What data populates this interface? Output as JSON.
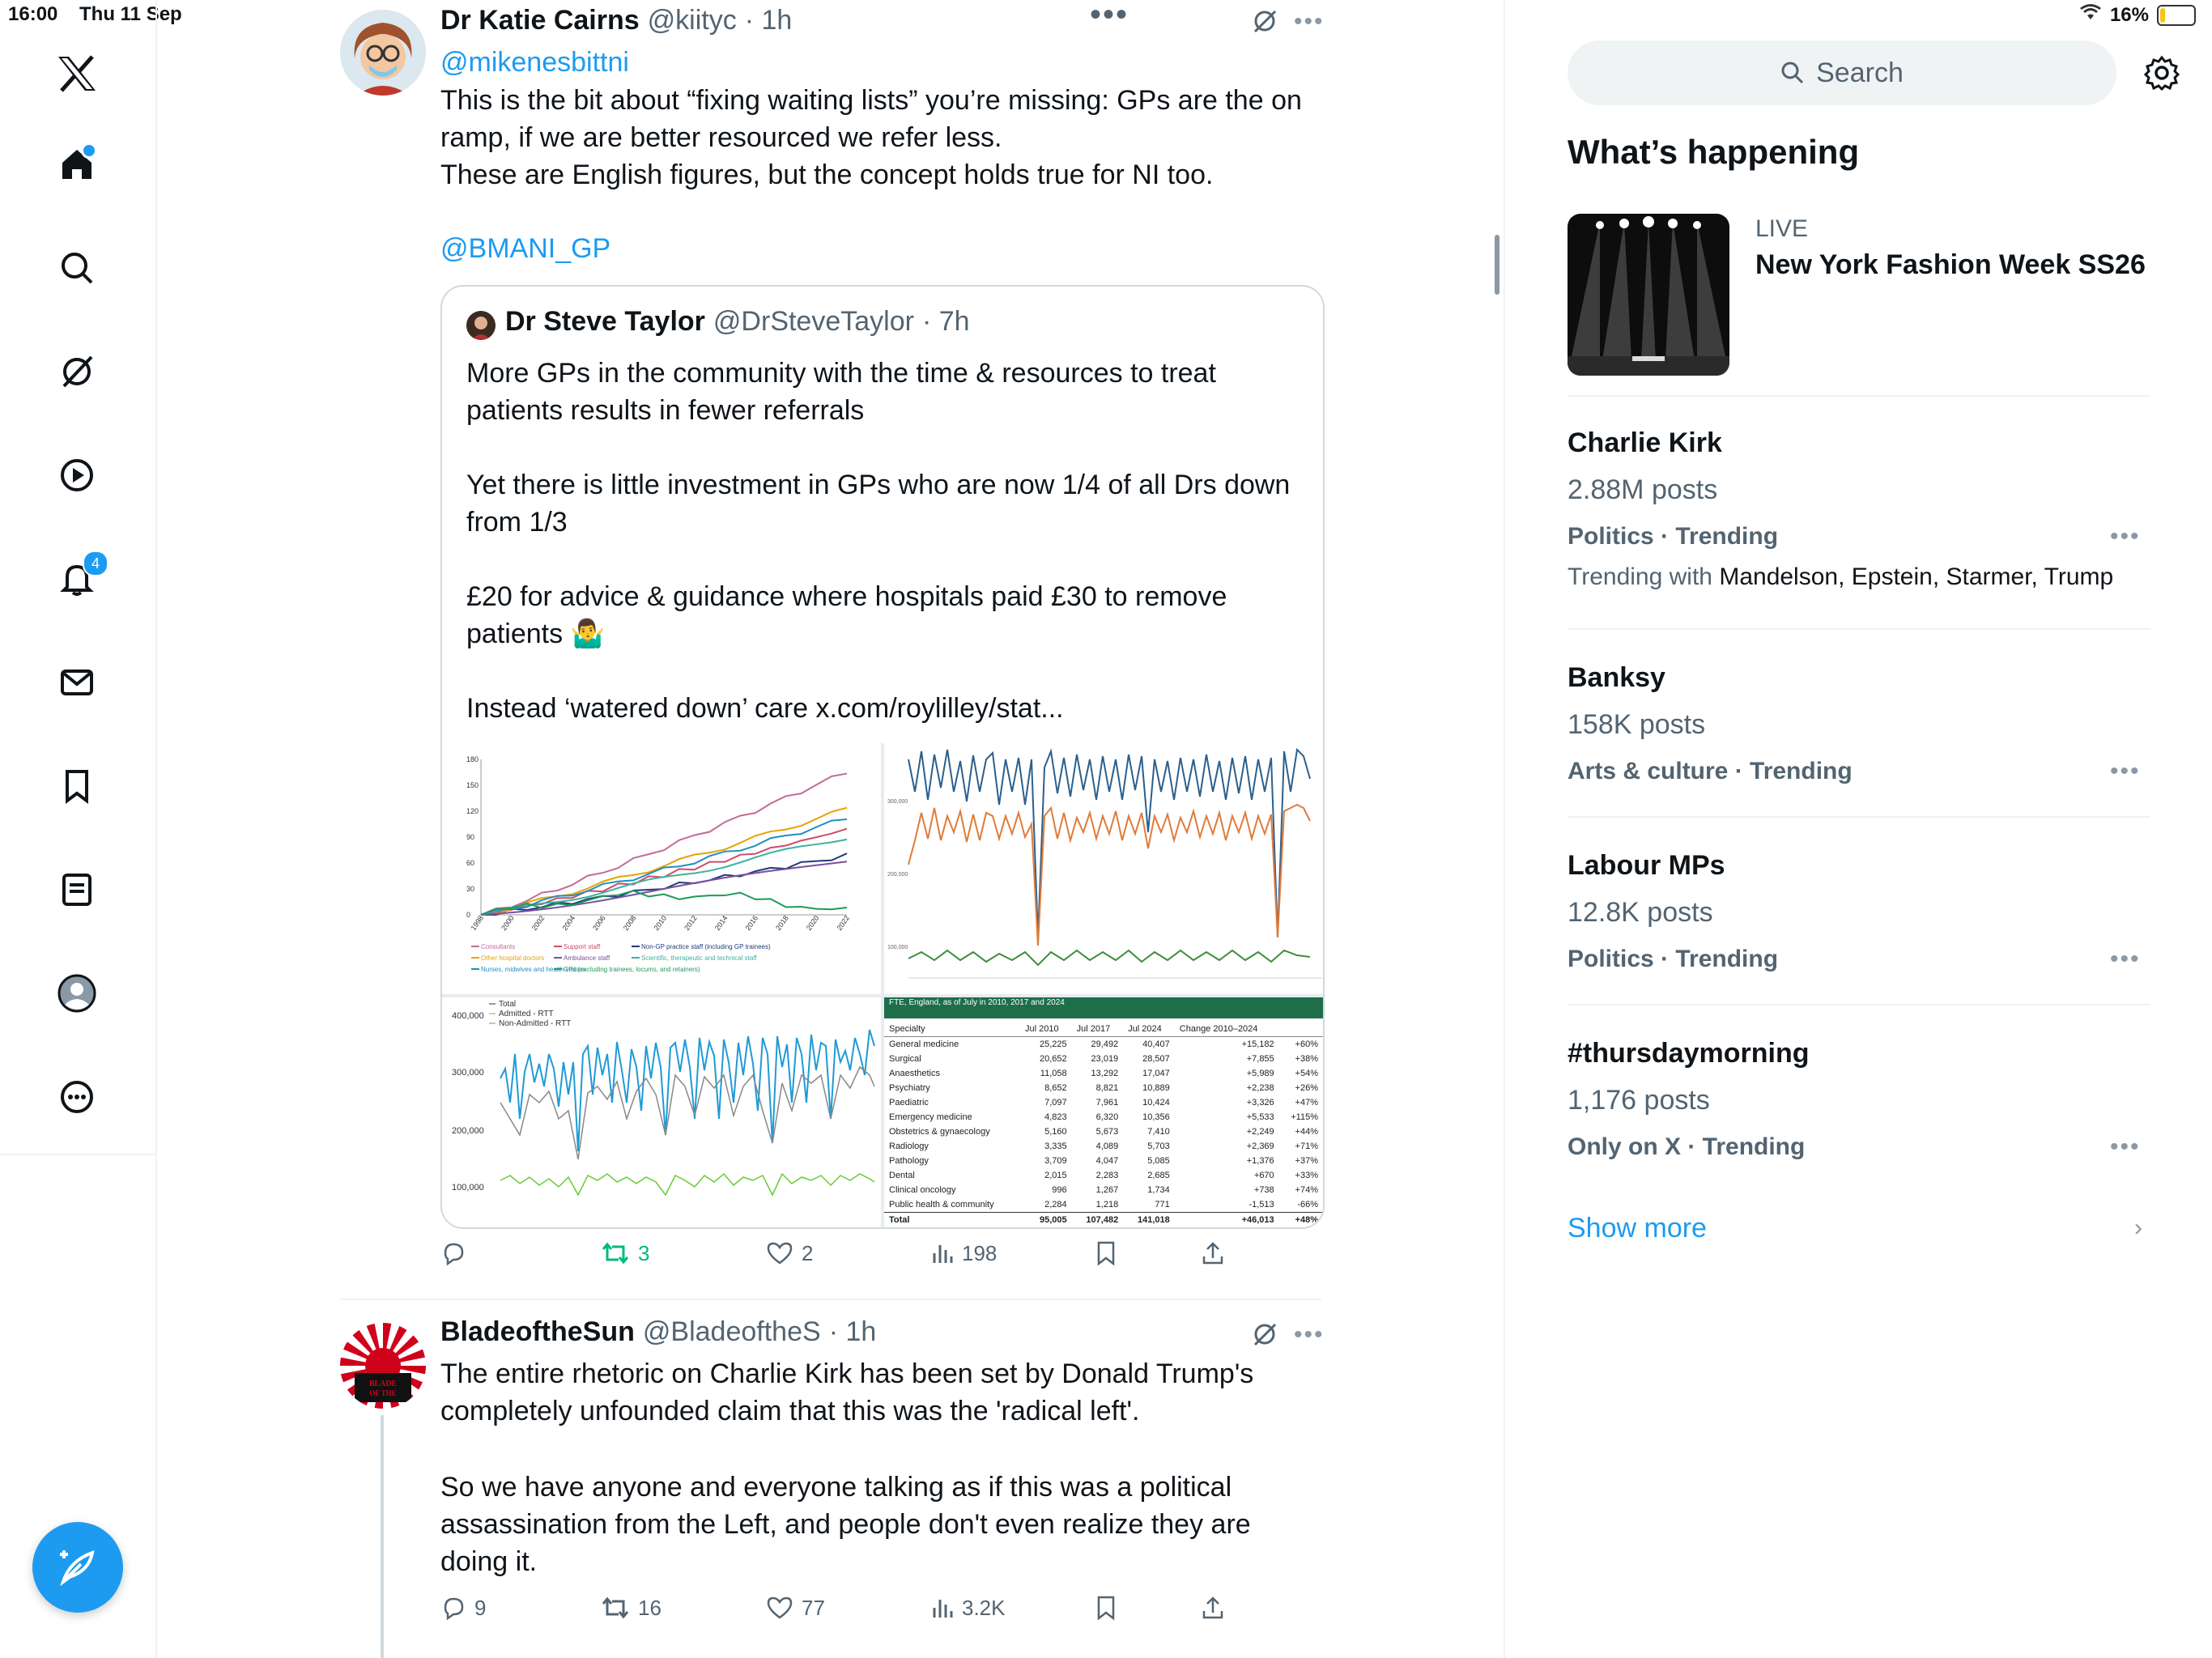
{
  "status": {
    "time": "16:00",
    "date": "Thu 11 Sep",
    "battery": "16%",
    "battery_level": 0.16
  },
  "nav": {
    "items": [
      "home-icon",
      "search-icon",
      "grok-icon",
      "video-icon",
      "notifications-icon",
      "messages-icon",
      "bookmarks-icon",
      "lists-icon",
      "profile-icon",
      "more-icon"
    ],
    "notifications_badge": "4"
  },
  "tweet1": {
    "name": "Dr Katie Cairns",
    "handle": "@kiityc",
    "time": "· 1h",
    "reply_to": "@mikenesbittni",
    "text": "This is the bit about “fixing waiting lists” you’re missing: GPs are the on ramp, if we are better resourced we refer less.\n These are English figures, but the concept holds true for NI too.",
    "mention": "@BMANI_GP",
    "quote": {
      "name": "Dr Steve Taylor",
      "handle": "@DrSteveTaylor",
      "time": "· 7h",
      "p1": "More GPs in the community with the time & resources to treat patients results in fewer referrals",
      "p2": "Yet there is little investment in GPs who are now 1/4 of all Drs down from 1/3",
      "p3": "£20 for advice & guidance where hospitals paid £30 to remove patients 🤷‍♂️",
      "p4": "Instead ‘watered down’ care x.com/roylilley/stat..."
    },
    "actions": {
      "retweets": "3",
      "likes": "2",
      "views": "198"
    }
  },
  "tweet2": {
    "name": "BladeoftheSun",
    "handle": "@BladeoftheS",
    "time": "· 1h",
    "avatar_text": "BLADE OF THE",
    "p1": "The entire rhetoric on Charlie Kirk has been set by Donald Trump's completely unfounded claim that this was the 'radical left'.",
    "p2": "So we have anyone and everyone talking as if this was a political assassination from the Left, and people don't even realize they are doing it.",
    "actions": {
      "replies": "9",
      "retweets": "16",
      "likes": "77",
      "views": "3.2K"
    }
  },
  "chart1": {
    "yticks": [
      "180",
      "150",
      "120",
      "90",
      "60",
      "30",
      "0"
    ],
    "xticks": [
      "1998",
      "2000",
      "2002",
      "2004",
      "2006",
      "2008",
      "2010",
      "2012",
      "2014",
      "2016",
      "2018",
      "2020",
      "2022"
    ],
    "legend": [
      {
        "label": "Consultants",
        "color": "#c46a9a"
      },
      {
        "label": "Support staff",
        "color": "#d04a6a"
      },
      {
        "label": "Non-GP practice staff (including GP trainees)",
        "color": "#1f3b7a"
      },
      {
        "label": "Other hospital doctors",
        "color": "#e6a400"
      },
      {
        "label": "Ambulance staff",
        "color": "#7a4fa0"
      },
      {
        "label": "Scientific, therapeutic and technical staff",
        "color": "#3bb3a0"
      },
      {
        "label": "Nurses, midwives and health visitors",
        "color": "#1f8fc4"
      },
      {
        "label": "GPs (excluding trainees, locums, and retainers)",
        "color": "#1f9a5a"
      }
    ]
  },
  "chart3": {
    "legend": [
      "Total",
      "Admitted - RTT",
      "Non-Admitted - RTT"
    ],
    "yticks": [
      "400,000",
      "300,000",
      "200,000",
      "100,000"
    ]
  },
  "table": {
    "caption": "FTE, England, as of July in 2010, 2017 and 2024",
    "headers": [
      "Specialty",
      "Jul 2010",
      "Jul 2017",
      "Jul 2024",
      "Change 2010–2024",
      ""
    ],
    "rows": [
      [
        "General medicine",
        "25,225",
        "29,492",
        "40,407",
        "+15,182",
        "+60%"
      ],
      [
        "Surgical",
        "20,652",
        "23,019",
        "28,507",
        "+7,855",
        "+38%"
      ],
      [
        "Anaesthetics",
        "11,058",
        "13,292",
        "17,047",
        "+5,989",
        "+54%"
      ],
      [
        "Psychiatry",
        "8,652",
        "8,821",
        "10,889",
        "+2,238",
        "+26%"
      ],
      [
        "Paediatric",
        "7,097",
        "7,961",
        "10,424",
        "+3,326",
        "+47%"
      ],
      [
        "Emergency medicine",
        "4,823",
        "6,320",
        "10,356",
        "+5,533",
        "+115%"
      ],
      [
        "Obstetrics & gynaecology",
        "5,160",
        "5,673",
        "7,410",
        "+2,249",
        "+44%"
      ],
      [
        "Radiology",
        "3,335",
        "4,089",
        "5,703",
        "+2,369",
        "+71%"
      ],
      [
        "Pathology",
        "3,709",
        "4,047",
        "5,085",
        "+1,376",
        "+37%"
      ],
      [
        "Dental",
        "2,015",
        "2,283",
        "2,685",
        "+670",
        "+33%"
      ],
      [
        "Clinical oncology",
        "996",
        "1,267",
        "1,734",
        "+738",
        "+74%"
      ],
      [
        "Public health & community",
        "2,284",
        "1,218",
        "771",
        "-1,513",
        "-66%"
      ]
    ],
    "total": [
      "Total",
      "95,005",
      "107,482",
      "141,018",
      "+46,013",
      "+48%"
    ]
  },
  "right": {
    "search_placeholder": "Search",
    "section_title": "What’s happening",
    "live": {
      "label": "LIVE",
      "title": "New York Fashion Week SS26"
    },
    "trends": [
      {
        "title": "Charlie Kirk",
        "posts": "2.88M posts",
        "category": "Politics · Trending",
        "with_label": "Trending with",
        "with": "Mandelson, Epstein, Starmer, Trump"
      },
      {
        "title": "Banksy",
        "posts": "158K posts",
        "category": "Arts & culture · Trending"
      },
      {
        "title": "Labour MPs",
        "posts": "12.8K posts",
        "category": "Politics · Trending"
      },
      {
        "title": "#thursdaymorning",
        "posts": "1,176 posts",
        "category": "Only on X · Trending"
      }
    ],
    "show_more": "Show more"
  }
}
